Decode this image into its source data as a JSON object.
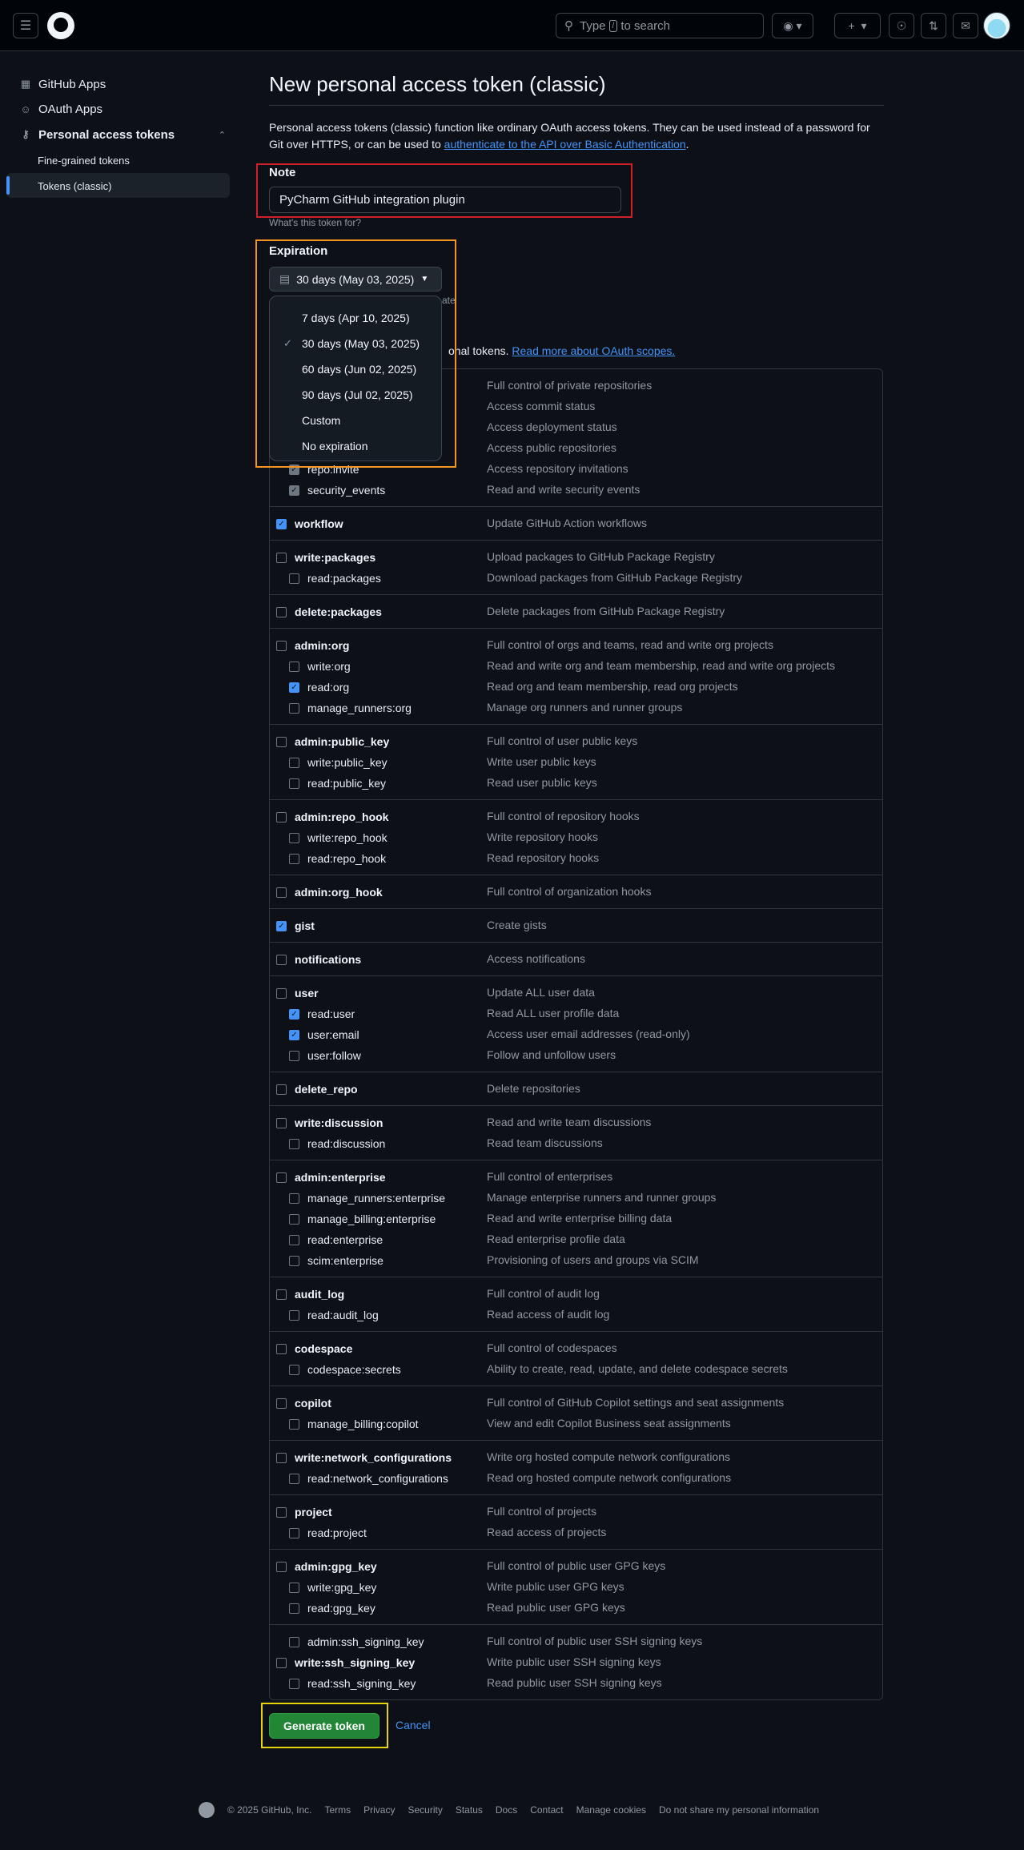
{
  "header": {
    "search_placeholder_prefix": "Type",
    "search_key": "/",
    "search_placeholder_suffix": "to search"
  },
  "sidebar": {
    "items": [
      {
        "label": "GitHub Apps",
        "icon": "apps-icon"
      },
      {
        "label": "OAuth Apps",
        "icon": "person-icon"
      },
      {
        "label": "Personal access tokens",
        "icon": "key-icon"
      }
    ],
    "sub_items": [
      {
        "label": "Fine-grained tokens"
      },
      {
        "label": "Tokens (classic)"
      }
    ]
  },
  "page": {
    "title": "New personal access token (classic)",
    "intro": "Personal access tokens (classic) function like ordinary OAuth access tokens. They can be used instead of a password for Git over HTTPS, or can be used to",
    "intro_link": "authenticate to the API over Basic Authentication",
    "intro_end": ".",
    "note_label": "Note",
    "note_value": "PyCharm GitHub integration plugin",
    "note_hint": "What's this token for?",
    "expiration_label": "Expiration",
    "expiration_value": "30 days (May 03, 2025)",
    "expiration_hint_fragment": "ate",
    "expiration_options": [
      {
        "label": "7 days (Apr 10, 2025)",
        "selected": false
      },
      {
        "label": "30 days (May 03, 2025)",
        "selected": true
      },
      {
        "label": "60 days (Jun 02, 2025)",
        "selected": false
      },
      {
        "label": "90 days (Jul 02, 2025)",
        "selected": false
      },
      {
        "label": "Custom",
        "selected": false
      },
      {
        "label": "No expiration",
        "selected": false
      }
    ],
    "scopes_text": "onal tokens.",
    "scopes_link": "Read more about OAuth scopes."
  },
  "scopes": [
    {
      "name": "",
      "desc": "Full control of private repositories",
      "checked": false,
      "hidden_name": true
    },
    {
      "name": "",
      "desc": "Access commit status",
      "hidden_name": true
    },
    {
      "name": "",
      "desc": "Access deployment status",
      "hidden_name": true
    },
    {
      "name": "",
      "desc": "Access public repositories",
      "hidden_name": true
    },
    {
      "name": "repo:invite",
      "desc": "Access repository invitations",
      "checked": true
    },
    {
      "name": "security_events",
      "desc": "Read and write security events",
      "checked": true
    },
    {
      "name": "workflow",
      "desc": "Update GitHub Action workflows",
      "checked": true
    },
    {
      "name": "write:packages",
      "desc": "Upload packages to GitHub Package Registry",
      "checked": false
    },
    {
      "name": "read:packages",
      "desc": "Download packages from GitHub Package Registry",
      "checked": false
    },
    {
      "name": "delete:packages",
      "desc": "Delete packages from GitHub Package Registry",
      "checked": false
    },
    {
      "name": "admin:org",
      "desc": "Full control of orgs and teams, read and write org projects",
      "checked": false
    },
    {
      "name": "write:org",
      "desc": "Read and write org and team membership, read and write org projects",
      "checked": false
    },
    {
      "name": "read:org",
      "desc": "Read org and team membership, read org projects",
      "checked": true
    },
    {
      "name": "manage_runners:org",
      "desc": "Manage org runners and runner groups",
      "checked": false
    },
    {
      "name": "admin:public_key",
      "desc": "Full control of user public keys",
      "checked": false
    },
    {
      "name": "write:public_key",
      "desc": "Write user public keys",
      "checked": false
    },
    {
      "name": "read:public_key",
      "desc": "Read user public keys",
      "checked": false
    },
    {
      "name": "admin:repo_hook",
      "desc": "Full control of repository hooks",
      "checked": false
    },
    {
      "name": "write:repo_hook",
      "desc": "Write repository hooks",
      "checked": false
    },
    {
      "name": "read:repo_hook",
      "desc": "Read repository hooks",
      "checked": false
    },
    {
      "name": "admin:org_hook",
      "desc": "Full control of organization hooks",
      "checked": false
    },
    {
      "name": "gist",
      "desc": "Create gists",
      "checked": true
    },
    {
      "name": "notifications",
      "desc": "Access notifications",
      "checked": false
    },
    {
      "name": "user",
      "desc": "Update ALL user data",
      "checked": false
    },
    {
      "name": "read:user",
      "desc": "Read ALL user profile data",
      "checked": true
    },
    {
      "name": "user:email",
      "desc": "Access user email addresses (read-only)",
      "checked": true
    },
    {
      "name": "user:follow",
      "desc": "Follow and unfollow users",
      "checked": false
    },
    {
      "name": "delete_repo",
      "desc": "Delete repositories",
      "checked": false
    },
    {
      "name": "write:discussion",
      "desc": "Read and write team discussions",
      "checked": false
    },
    {
      "name": "read:discussion",
      "desc": "Read team discussions",
      "checked": false
    },
    {
      "name": "admin:enterprise",
      "desc": "Full control of enterprises",
      "checked": false
    },
    {
      "name": "manage_runners:enterprise",
      "desc": "Manage enterprise runners and runner groups",
      "checked": false
    },
    {
      "name": "manage_billing:enterprise",
      "desc": "Read and write enterprise billing data",
      "checked": false
    },
    {
      "name": "read:enterprise",
      "desc": "Read enterprise profile data",
      "checked": false
    },
    {
      "name": "scim:enterprise",
      "desc": "Provisioning of users and groups via SCIM",
      "checked": false
    },
    {
      "name": "audit_log",
      "desc": "Full control of audit log",
      "checked": false
    },
    {
      "name": "read:audit_log",
      "desc": "Read access of audit log",
      "checked": false
    },
    {
      "name": "codespace",
      "desc": "Full control of codespaces",
      "checked": false
    },
    {
      "name": "codespace:secrets",
      "desc": "Ability to create, read, update, and delete codespace secrets",
      "checked": false
    },
    {
      "name": "copilot",
      "desc": "Full control of GitHub Copilot settings and seat assignments",
      "checked": false
    },
    {
      "name": "manage_billing:copilot",
      "desc": "View and edit Copilot Business seat assignments",
      "checked": false
    },
    {
      "name": "write:network_configurations",
      "desc": "Write org hosted compute network configurations",
      "checked": false
    },
    {
      "name": "read:network_configurations",
      "desc": "Read org hosted compute network configurations",
      "checked": false
    },
    {
      "name": "project",
      "desc": "Full control of projects",
      "checked": false
    },
    {
      "name": "read:project",
      "desc": "Read access of projects",
      "checked": false
    },
    {
      "name": "admin:gpg_key",
      "desc": "Full control of public user GPG keys",
      "checked": false
    },
    {
      "name": "write:gpg_key",
      "desc": "Write public user GPG keys",
      "checked": false
    },
    {
      "name": "read:gpg_key",
      "desc": "Read public user GPG keys",
      "checked": false
    },
    {
      "name": "admin:ssh_signing_key",
      "desc": "Full control of public user SSH signing keys",
      "checked": false
    },
    {
      "name": "write:ssh_signing_key",
      "desc": "Write public user SSH signing keys",
      "checked": false
    },
    {
      "name": "read:ssh_signing_key",
      "desc": "Read public user SSH signing keys",
      "checked": false
    }
  ],
  "actions": {
    "generate_label": "Generate token",
    "cancel_label": "Cancel"
  },
  "footer": {
    "copyright": "© 2025 GitHub, Inc.",
    "links": [
      "Terms",
      "Privacy",
      "Security",
      "Status",
      "Docs",
      "Contact",
      "Manage cookies",
      "Do not share my personal information"
    ]
  },
  "colors": {
    "background": "#0d1117",
    "header_bg": "#010409",
    "link": "#4493f8",
    "primary_button": "#238636",
    "annotation_red": "#d0202a",
    "annotation_orange": "#f29322",
    "annotation_yellow": "#e6d30a"
  }
}
